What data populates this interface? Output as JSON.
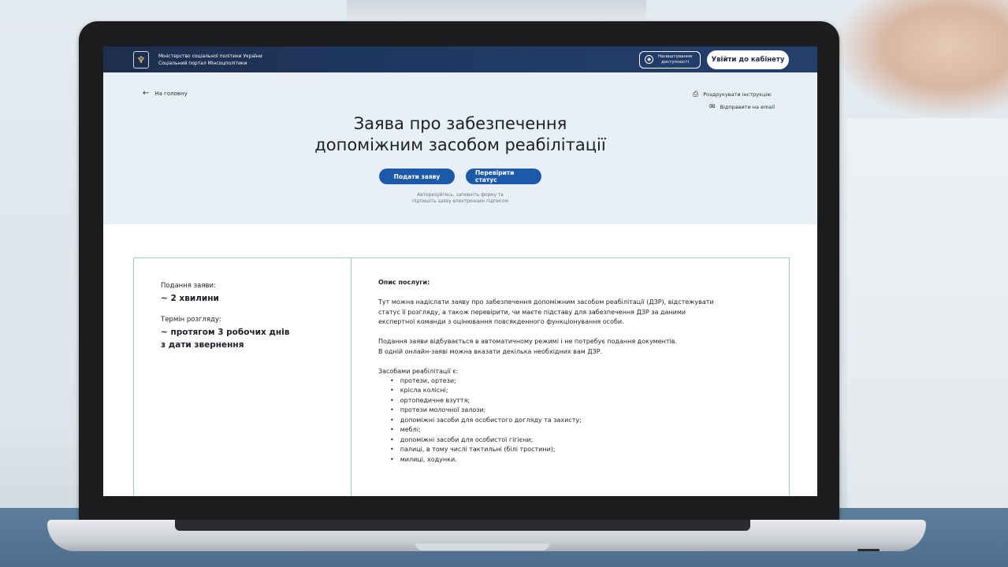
{
  "header": {
    "ministry_line1": "Міністерство соціальної політики України",
    "ministry_line2": "Соціальний портал Мінсоцполітики",
    "accessibility_line1": "Налаштування",
    "accessibility_line2": "доступності",
    "login_label": "Увійти до кабінету"
  },
  "hero": {
    "back_label": "На головну",
    "print_label": "Роздрукувати інструкцію",
    "email_label": "Відправити на email",
    "title_line1": "Заява про забезпечення",
    "title_line2": "допоміжним засобом реабілітації",
    "submit_label": "Подати заяву",
    "status_label": "Перевірити статус",
    "note_line1": "Авторизуйтесь, заповніть форму та",
    "note_line2": "підпишіть заяву електронним підписом"
  },
  "info": {
    "submission_label": "Подання заяви:",
    "submission_value": "~ 2 хвилини",
    "review_label": "Термін розгляду:",
    "review_value_line1": "~ протягом 3 робочих днів",
    "review_value_line2": "з дати звернення"
  },
  "description": {
    "title": "Опис послуги:",
    "paragraph1": "Тут можна надіслати заяву про забезпечення допоміжним засобом реабілітації (ДЗР), відстежувати\nстатус її розгляду, а також перевірити, чи маєте підставу для забезпечення ДЗР за даними\nекспертної команди з оцінювання повсякденного функціонування особи.",
    "paragraph2": "Подання заяви відбувається в автоматичному режимі і не потребує подання документів.\nВ одній онлайн-заяві можна вказати декілька необхідних вам ДЗР.",
    "aids_title": "Засобами реабілітації є:",
    "aids": [
      "протези, ортези;",
      "крісла колісні;",
      "ортопедичне взуття;",
      "протези молочної залози;",
      "допоміжні засоби для особистого догляду та захисту;",
      "меблі;",
      "допоміжні засоби для особистої гігієни;",
      "палиці, в тому числі тактильні (білі тростини);",
      "милиці, ходунки."
    ]
  }
}
